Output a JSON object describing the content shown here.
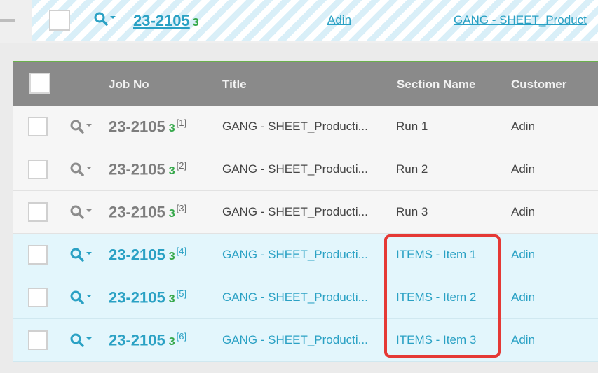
{
  "top": {
    "job_no": "23-2105",
    "version": "3",
    "customer": "Adin",
    "title": "GANG - SHEET_Product"
  },
  "table": {
    "headers": {
      "job_no": "Job No",
      "title": "Title",
      "section": "Section Name",
      "customer": "Customer"
    },
    "rows": [
      {
        "job_no": "23-2105",
        "version": "3",
        "index": "[1]",
        "title": "GANG - SHEET_Producti...",
        "section": "Run 1",
        "customer": "Adin"
      },
      {
        "job_no": "23-2105",
        "version": "3",
        "index": "[2]",
        "title": "GANG - SHEET_Producti...",
        "section": "Run 2",
        "customer": "Adin"
      },
      {
        "job_no": "23-2105",
        "version": "3",
        "index": "[3]",
        "title": "GANG - SHEET_Producti...",
        "section": "Run 3",
        "customer": "Adin"
      },
      {
        "job_no": "23-2105",
        "version": "3",
        "index": "[4]",
        "title": "GANG - SHEET_Producti...",
        "section": "ITEMS - Item 1",
        "customer": "Adin"
      },
      {
        "job_no": "23-2105",
        "version": "3",
        "index": "[5]",
        "title": "GANG - SHEET_Producti...",
        "section": "ITEMS - Item 2",
        "customer": "Adin"
      },
      {
        "job_no": "23-2105",
        "version": "3",
        "index": "[6]",
        "title": "GANG - SHEET_Producti...",
        "section": "ITEMS - Item 3",
        "customer": "Adin"
      }
    ]
  },
  "colors": {
    "link": "#2aa1c4",
    "version_green": "#35a84a",
    "header_bg": "#8a8a8a",
    "highlight_row": "#e3f6fc",
    "annotation_red": "#e53935"
  },
  "icons": {
    "search": "search-icon",
    "dropdown": "chevron-down-icon"
  }
}
